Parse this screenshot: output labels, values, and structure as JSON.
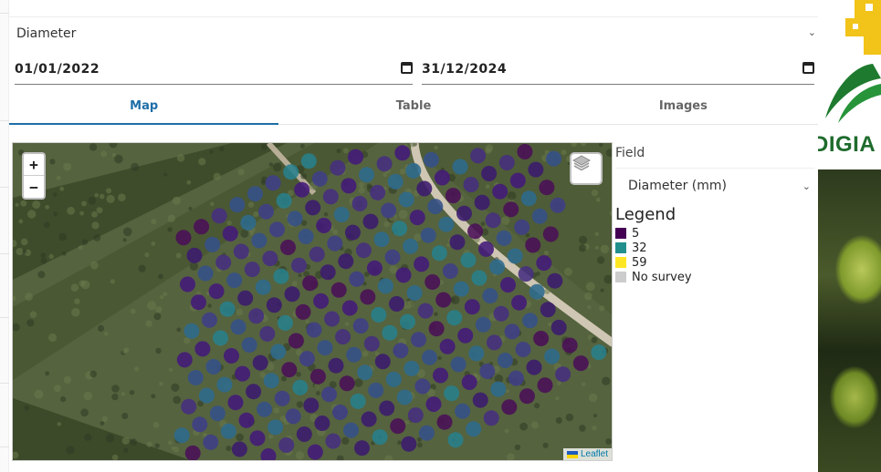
{
  "field_select": {
    "value": "Diameter"
  },
  "date_range": {
    "start": "01/01/2022",
    "end": "31/12/2024"
  },
  "tabs": [
    {
      "label": "Map",
      "active": true
    },
    {
      "label": "Table",
      "active": false
    },
    {
      "label": "Images",
      "active": false
    }
  ],
  "map": {
    "zoom_in": "+",
    "zoom_out": "−",
    "attribution": "Leaflet"
  },
  "side": {
    "field_label": "Field",
    "field_value": "Diameter (mm)",
    "legend_title": "Legend",
    "legend": [
      {
        "label": "5",
        "color": "#440154"
      },
      {
        "label": "32",
        "color": "#21908d"
      },
      {
        "label": "59",
        "color": "#fde725"
      },
      {
        "label": "No survey",
        "color": "#cccccc"
      }
    ]
  },
  "logo": {
    "text": "DIGIA"
  }
}
